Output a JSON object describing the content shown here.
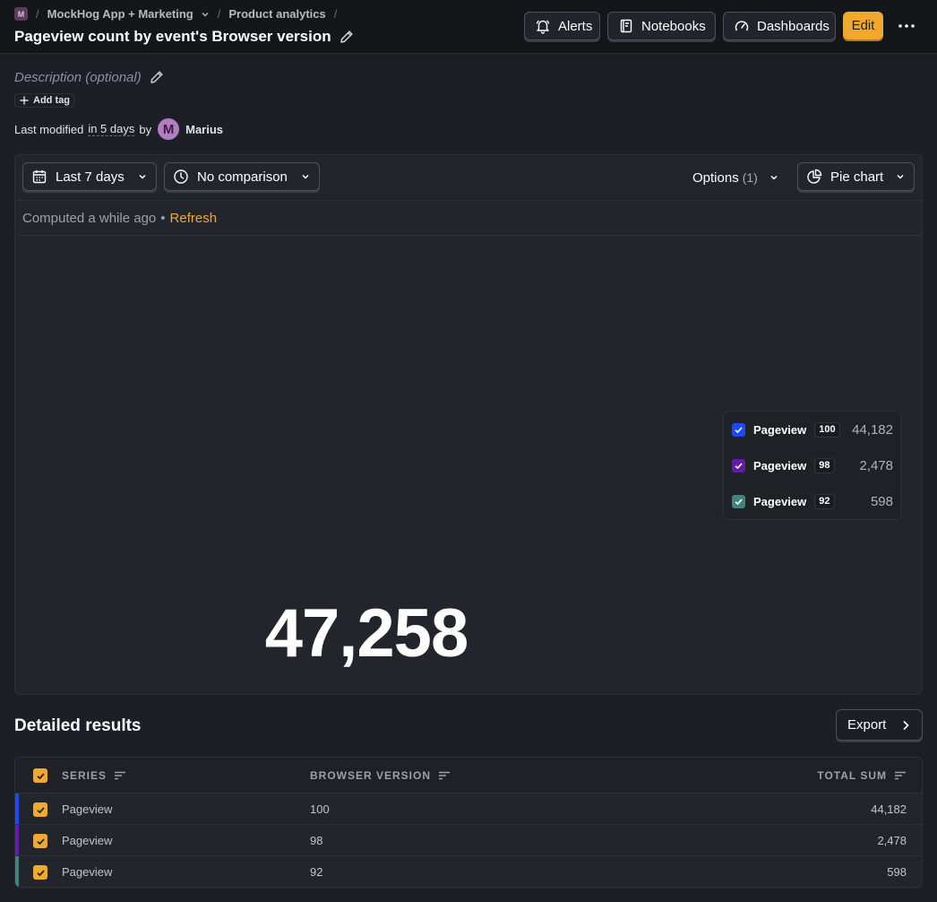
{
  "colors": {
    "accent": "#f1a82c",
    "series_1": "#1d4aff",
    "series_2": "#621da6",
    "series_3": "#42827e",
    "background": "#1d1f27"
  },
  "breadcrumb": {
    "workspace_badge": "M",
    "project": "MockHog App + Marketing",
    "section": "Product analytics"
  },
  "page": {
    "title": "Pageview count by event's Browser version",
    "description_placeholder": "Description (optional)",
    "add_tag_label": "Add tag",
    "modified_prefix": "Last modified",
    "modified_time": "in 5 days",
    "modified_by": "by",
    "author_initial": "M",
    "author_name": "Marius"
  },
  "header_actions": {
    "alerts": "Alerts",
    "notebooks": "Notebooks",
    "dashboards": "Dashboards",
    "edit": "Edit"
  },
  "toolbar": {
    "date_range": "Last 7 days",
    "comparison": "No comparison",
    "options_label": "Options",
    "options_count": "(1)",
    "chart_type": "Pie chart"
  },
  "status": {
    "computed": "Computed a while ago",
    "separator": "•",
    "refresh": "Refresh"
  },
  "chart_data": {
    "type": "pie",
    "total": "47,258",
    "series": [
      {
        "name": "Pageview",
        "breakdown": "100",
        "value": 44182,
        "display": "44,182"
      },
      {
        "name": "Pageview",
        "breakdown": "98",
        "value": 2478,
        "display": "2,478"
      },
      {
        "name": "Pageview",
        "breakdown": "92",
        "value": 598,
        "display": "598"
      }
    ]
  },
  "results": {
    "title": "Detailed results",
    "export_label": "Export",
    "columns": [
      "SERIES",
      "BROWSER VERSION",
      "TOTAL SUM"
    ],
    "rows": [
      {
        "series": "Pageview",
        "version": "100",
        "total": "44,182"
      },
      {
        "series": "Pageview",
        "version": "98",
        "total": "2,478"
      },
      {
        "series": "Pageview",
        "version": "92",
        "total": "598"
      }
    ]
  }
}
